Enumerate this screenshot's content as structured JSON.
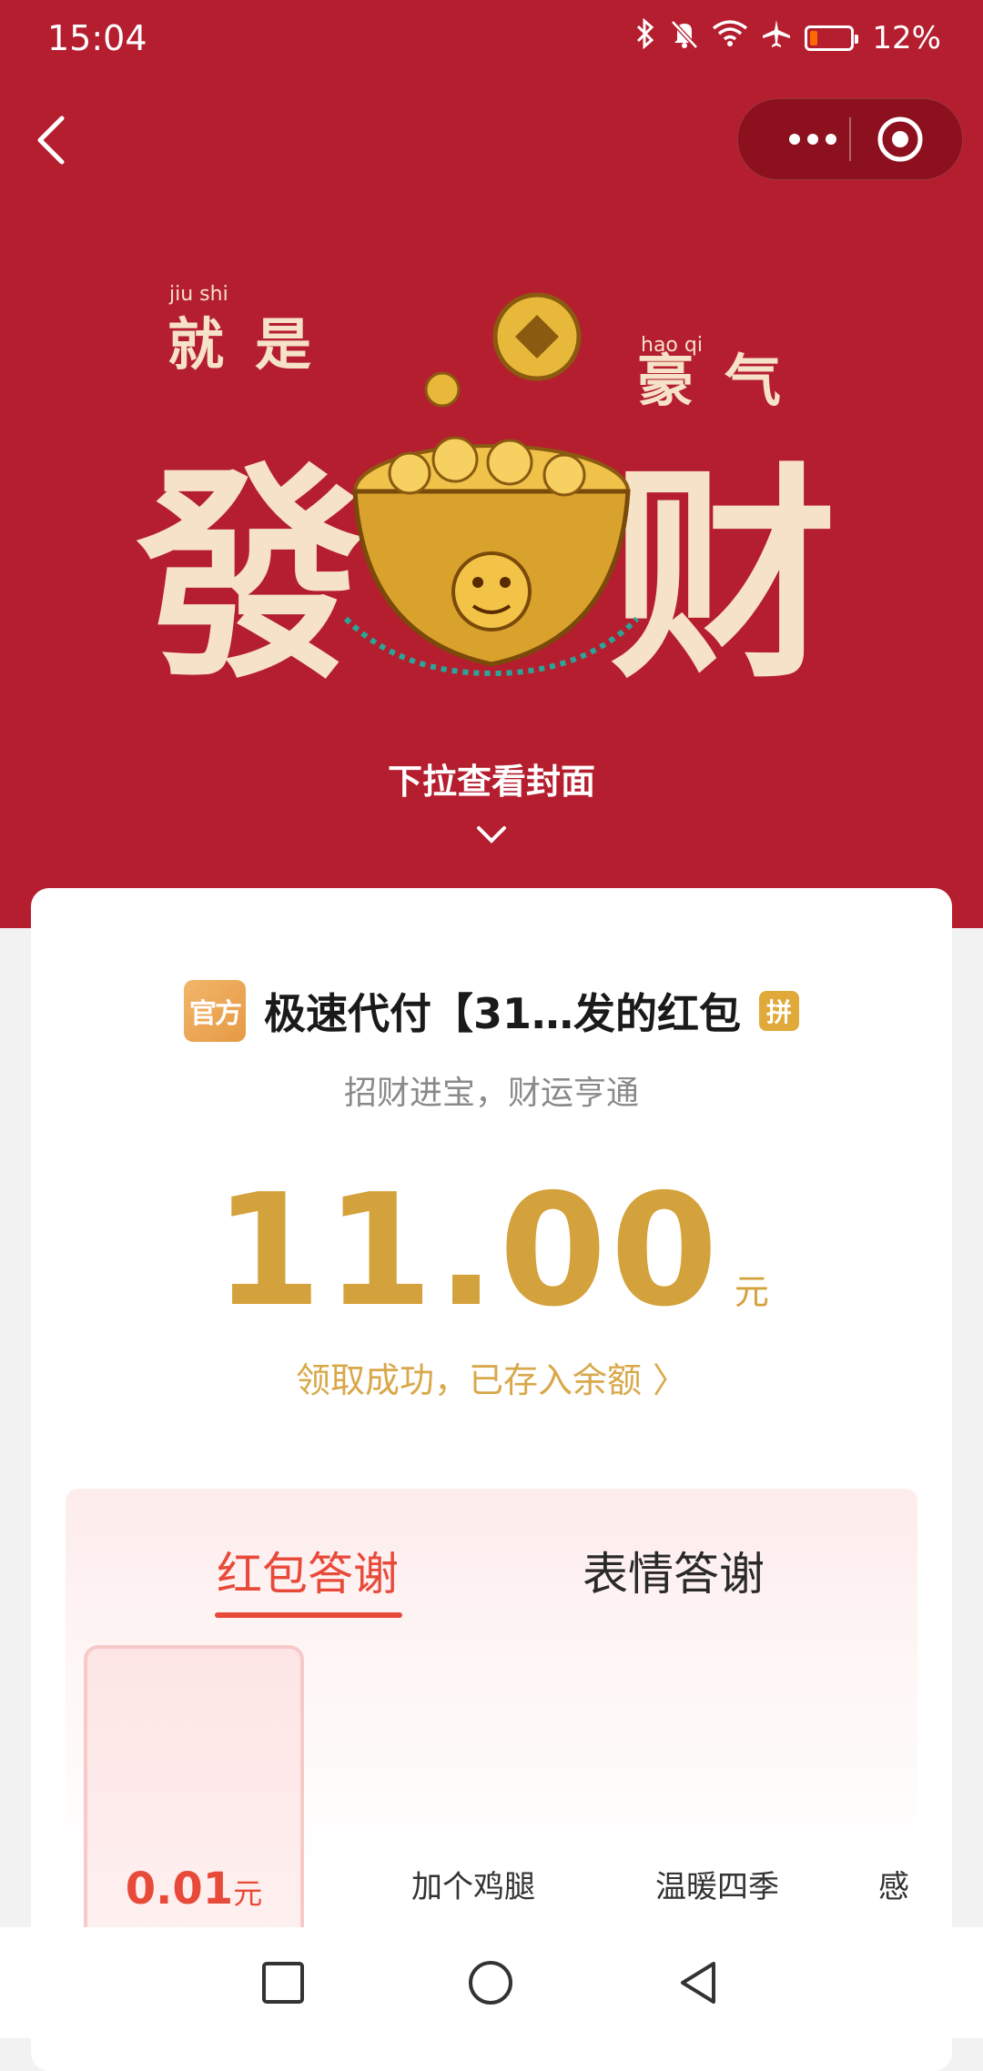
{
  "status_bar": {
    "time": "15:04",
    "battery": "12%"
  },
  "cover": {
    "small_left": "就是",
    "small_left_pinyin": "jiu shi",
    "small_right": "豪气",
    "small_right_pinyin": "hao qi",
    "big_left": "發",
    "big_right": "财",
    "pull_hint": "下拉查看封面"
  },
  "card": {
    "official_badge": "官方",
    "sender": "极速代付【31…发的红包",
    "pin_badge": "拼",
    "blessing": "招财进宝，财运亨通",
    "amount": "11.00",
    "unit": "元",
    "claimed": "领取成功，已存入余额 〉"
  },
  "thanks": {
    "tabs": [
      "红包答谢",
      "表情答谢"
    ],
    "options": [
      {
        "value": "0.01",
        "unit": "元"
      },
      {
        "label": "加个鸡腿"
      },
      {
        "label": "温暖四季"
      },
      {
        "label": "感"
      }
    ]
  },
  "colors": {
    "header": "#b51e2f",
    "gold": "#d4a23c",
    "accent_red": "#e84a3a"
  }
}
